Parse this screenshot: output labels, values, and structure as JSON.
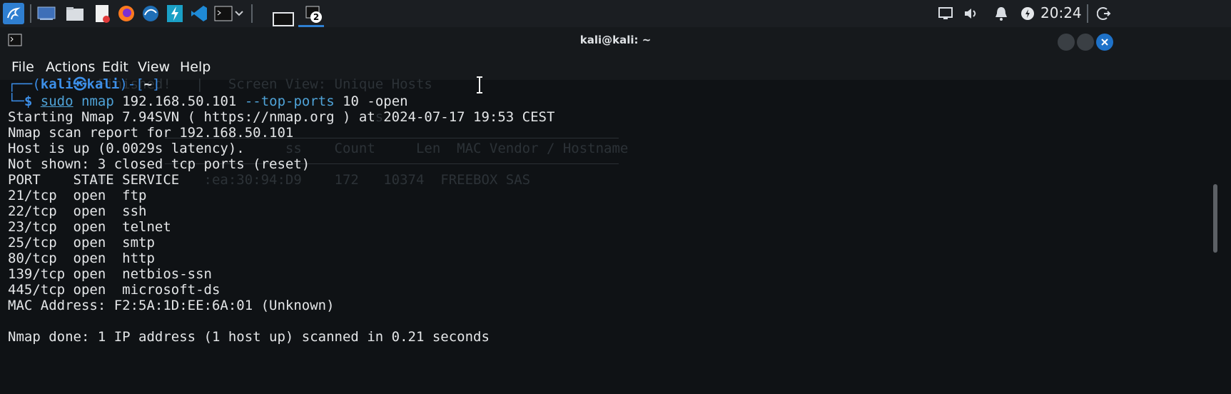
{
  "taskbar": {
    "clock": "20:24",
    "workspace_badge": "2"
  },
  "window": {
    "title": "kali@kali: ~"
  },
  "menu": [
    "File",
    "Actions",
    "Edit",
    "View",
    "Help"
  ],
  "prompt": {
    "open": "┌──(",
    "user": "kali",
    "at": "㉿",
    "host": "kali",
    "close": ")-[",
    "dir": "~",
    "end": "]",
    "corner": "└─",
    "dollar": "$",
    "cmd_sudo": "sudo",
    "cmd_nmap": "nmap",
    "cmd_args": " 192.168.50.101 ",
    "cmd_flag": "--top-ports",
    "cmd_rest": " 10 -open"
  },
  "output": [
    "Starting Nmap 7.94SVN ( https://nmap.org ) at 2024-07-17 19:53 CEST",
    "Nmap scan report for 192.168.50.101",
    "Host is up (0.0029s latency).",
    "Not shown: 3 closed tcp ports (reset)",
    "PORT    STATE SERVICE",
    "21/tcp  open  ftp",
    "22/tcp  open  ssh",
    "23/tcp  open  telnet",
    "25/tcp  open  smtp",
    "80/tcp  open  http",
    "139/tcp open  netbios-ssn",
    "445/tcp open  microsoft-ds",
    "MAC Address: F2:5A:1D:EE:6A:01 (Unknown)",
    "",
    "Nmap done: 1 IP address (1 host up) scanned in 0.21 seconds"
  ],
  "ghost_text": {
    "line1": "         : Finished!   |   Screen View: Unique Hosts",
    "line2": "                                             s",
    "line3": "                                  ss    Count     Len  MAC Vendor / Hostname",
    "line4": "         .105           :ea:30:94:D9    172   10374  FREEBOX SAS"
  }
}
